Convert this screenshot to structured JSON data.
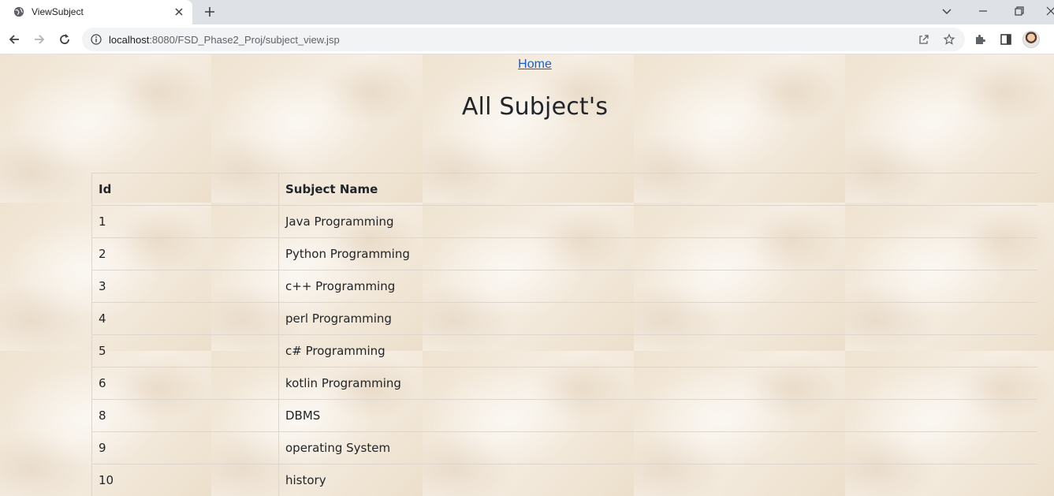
{
  "browser": {
    "tab_title": "ViewSubject",
    "url_host": "localhost",
    "url_rest": ":8080/FSD_Phase2_Proj/subject_view.jsp"
  },
  "page": {
    "home_link": "Home",
    "title": "All Subject's"
  },
  "table": {
    "headers": [
      "Id",
      "Subject Name"
    ],
    "rows": [
      {
        "id": "1",
        "name": "Java Programming"
      },
      {
        "id": "2",
        "name": "Python Programming"
      },
      {
        "id": "3",
        "name": "c++ Programming"
      },
      {
        "id": "4",
        "name": "perl Programming"
      },
      {
        "id": "5",
        "name": "c# Programming"
      },
      {
        "id": "6",
        "name": "kotlin Programming"
      },
      {
        "id": "8",
        "name": "DBMS"
      },
      {
        "id": "9",
        "name": "operating System"
      },
      {
        "id": "10",
        "name": "history"
      }
    ]
  },
  "colors": {
    "link": "#1a5fc9",
    "text": "#212529",
    "tabbar": "#dee1e6"
  }
}
